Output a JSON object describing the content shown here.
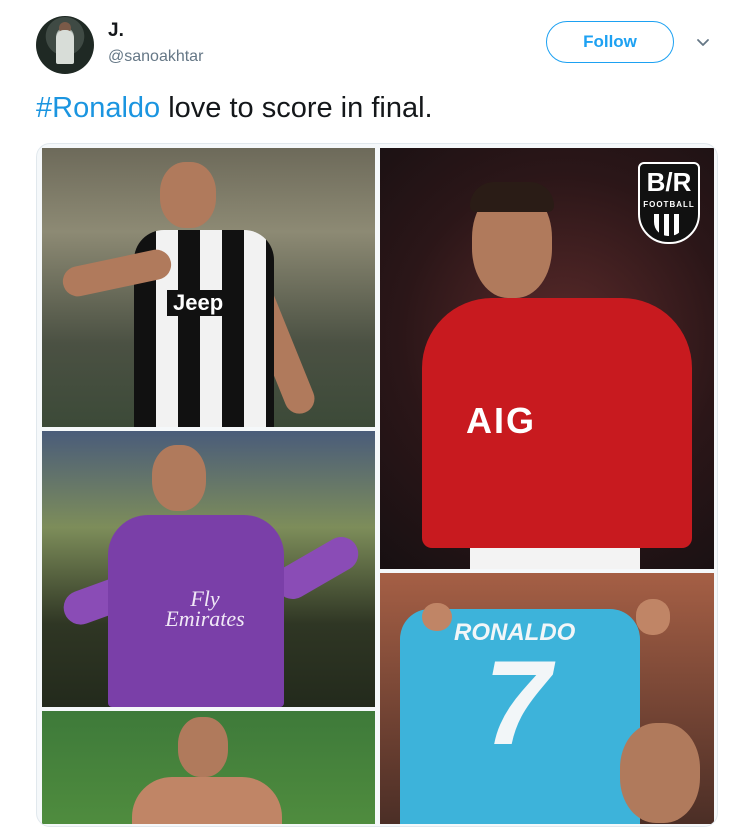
{
  "tweet": {
    "author": {
      "display_name": "J.",
      "handle": "@sanoakhtar",
      "avatar": "user-avatar"
    },
    "follow_label": "Follow",
    "menu_icon": "chevron-down-icon",
    "text": {
      "hashtag": "#Ronaldo",
      "body": " love to score in final."
    },
    "media": {
      "panels": [
        {
          "shirt_text": "Jeep"
        },
        {
          "shirt_text": "Fly Emirates"
        },
        {
          "shirt_text": ""
        },
        {
          "shirt_text": "AIG",
          "badge_logo": "B/R",
          "badge_sub": "FOOTBALL"
        },
        {
          "shirt_name": "RONALDO",
          "shirt_number": "7"
        }
      ]
    },
    "colors": {
      "accent": "#1da1f2",
      "hashtag": "#1b95e0",
      "handle": "#657786"
    }
  }
}
